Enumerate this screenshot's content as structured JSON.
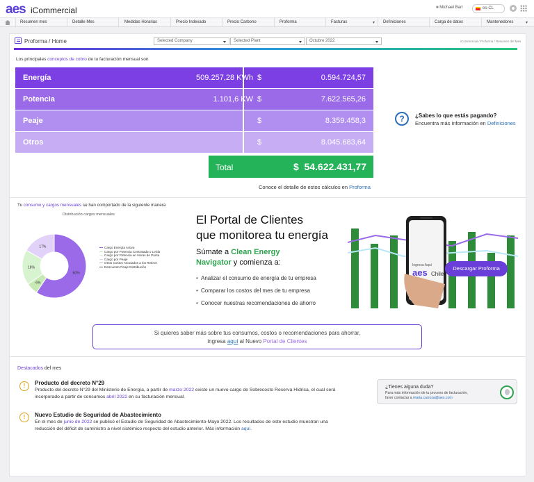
{
  "app": {
    "logo": "aes",
    "name": "iCommercial"
  },
  "topbar": {
    "user": "Michael Barr",
    "language": "es-CL"
  },
  "nav": [
    "Resumen mes",
    "Detalle Mes",
    "Medidas Horarias",
    "Precio Indexado",
    "Precio Carbono",
    "Proforma",
    "Facturas",
    "Definiciones",
    "Carga de datos",
    "Mantenedores"
  ],
  "header": {
    "title": "Proforma / Home",
    "company_placeholder": "Selected Company",
    "plant_placeholder": "Selected Plant",
    "period": "Octubre 2022",
    "breadcrumb": "iCommercial / Proforma / Resumen del Mes"
  },
  "summary": {
    "intro_pre": "Los principales ",
    "intro_accent": "conceptos de cobro",
    "intro_post": " de tu facturación mensual son",
    "rows": [
      {
        "label": "Energía",
        "qty": "509.257,28 KWh",
        "currency": "$",
        "amount": "0.594.724,57",
        "color": "#7b3fe4"
      },
      {
        "label": "Potencia",
        "qty": "1.101,6 KW",
        "currency": "$",
        "amount": "7.622.565,26",
        "color": "#9b6ae9"
      },
      {
        "label": "Peaje",
        "qty": "",
        "currency": "$",
        "amount": "8.359.458,3",
        "color": "#b08ff0"
      },
      {
        "label": "Otros",
        "qty": "",
        "currency": "$",
        "amount": "8.045.683,64",
        "color": "#c6adf4"
      }
    ],
    "total_label": "Total",
    "total_currency": "$",
    "total_amount": "54.622.431,77",
    "calc_pre": "Conoce el detalle de estos cálculos en ",
    "calc_link": "Proforma"
  },
  "help": {
    "question": "¿Sabes lo que estás pagando?",
    "answer_pre": "Encuentra más información en ",
    "answer_link": "Definiciones"
  },
  "consumption": {
    "intro_pre": "Tu ",
    "intro_accent": "consumo y cargos mensuales",
    "intro_post": " se han comportado de la siguiente manera",
    "chart_title": "Distribución cargos mensuales"
  },
  "chart_data": {
    "type": "pie",
    "title": "Distribución cargos mensuales",
    "slices": [
      {
        "label": "Cargo Energía Activa",
        "value": 60,
        "color": "#9b6ae9"
      },
      {
        "label": "Cargo por Potencia Contratada o Leída",
        "value": 6,
        "color": "#c7e9b4"
      },
      {
        "label": "Cargo por Potencia en Horas de Punta",
        "value": 18,
        "color": "#d8f3d0"
      },
      {
        "label": "Cargo por Peaje",
        "value": 17,
        "color": "#e2d2fa"
      },
      {
        "label": "Otros Costos Asociados a los Retiros",
        "value": 0,
        "color": "#bbbbbb"
      },
      {
        "label": "Descuento Peaje Distribución",
        "value": 0,
        "color": "#555555"
      }
    ],
    "slice_labels": [
      "60%",
      "6%",
      "18%",
      "17%"
    ],
    "legend_position": "right"
  },
  "portal": {
    "heading1": "El Portal de Clientes",
    "heading2": "que monitorea tu energía",
    "sub_pre": "Súmate a ",
    "sub_brand1": "Clean Energy",
    "sub_brand2": "Navigator",
    "sub_post": " y comienza a:",
    "bullets": [
      "Analizar el consumo de energía de tu empresa",
      "Comparar los costos del mes de tu empresa",
      "Conocer nuestras recomendaciones de ahorro"
    ],
    "phone_small": "Ingresa Aquí",
    "phone_brand": "aes",
    "phone_country": "Chile",
    "download_button": "Descargar Proforma"
  },
  "info_box": {
    "line1": "Si quieres saber más sobre tus consumos, costos o recomendaciones para ahorrar,",
    "line2_pre": "ingresa ",
    "line2_link": "aquí",
    "line2_mid": " al Nuevo ",
    "line2_link2": "Portal de Clientes"
  },
  "highlights": {
    "label_accent": "Destacados",
    "label_post": " del mes",
    "items": [
      {
        "title": "Producto del decreto N°29",
        "b1": "Producto del decreto N°29 del Ministerio de Energía, a partir de ",
        "b1_accent": "marzo 2022",
        "b2": " existe un nuevo cargo de Sobrecosto Reserva Hídrica, el cual será",
        "b3": "incorporado a partir de consumos ",
        "b3_accent": "abril 2022",
        "b4": " en su facturación mensual."
      },
      {
        "title": "Nuevo Estudio de Seguridad de Abastecimiento",
        "b1": "En el mes de ",
        "b1_accent": "junio de 2022",
        "b2": " se publicó el Estudio de Seguridad de Abastecimiento-Mayo 2022. Los resultados de este estudio muestran una",
        "b3": "reducción del déficit de suministro a nivel sistémico respecto del estudio anterior. Más información ",
        "b3_accent": "aquí",
        "b4": "."
      }
    ]
  },
  "doubt": {
    "question": "¿Tienes alguna duda?",
    "line1": "Para más información de tu proceso de facturación,",
    "line2_pre": "favor contactar a ",
    "email": "maria.carroza@aes.com"
  }
}
